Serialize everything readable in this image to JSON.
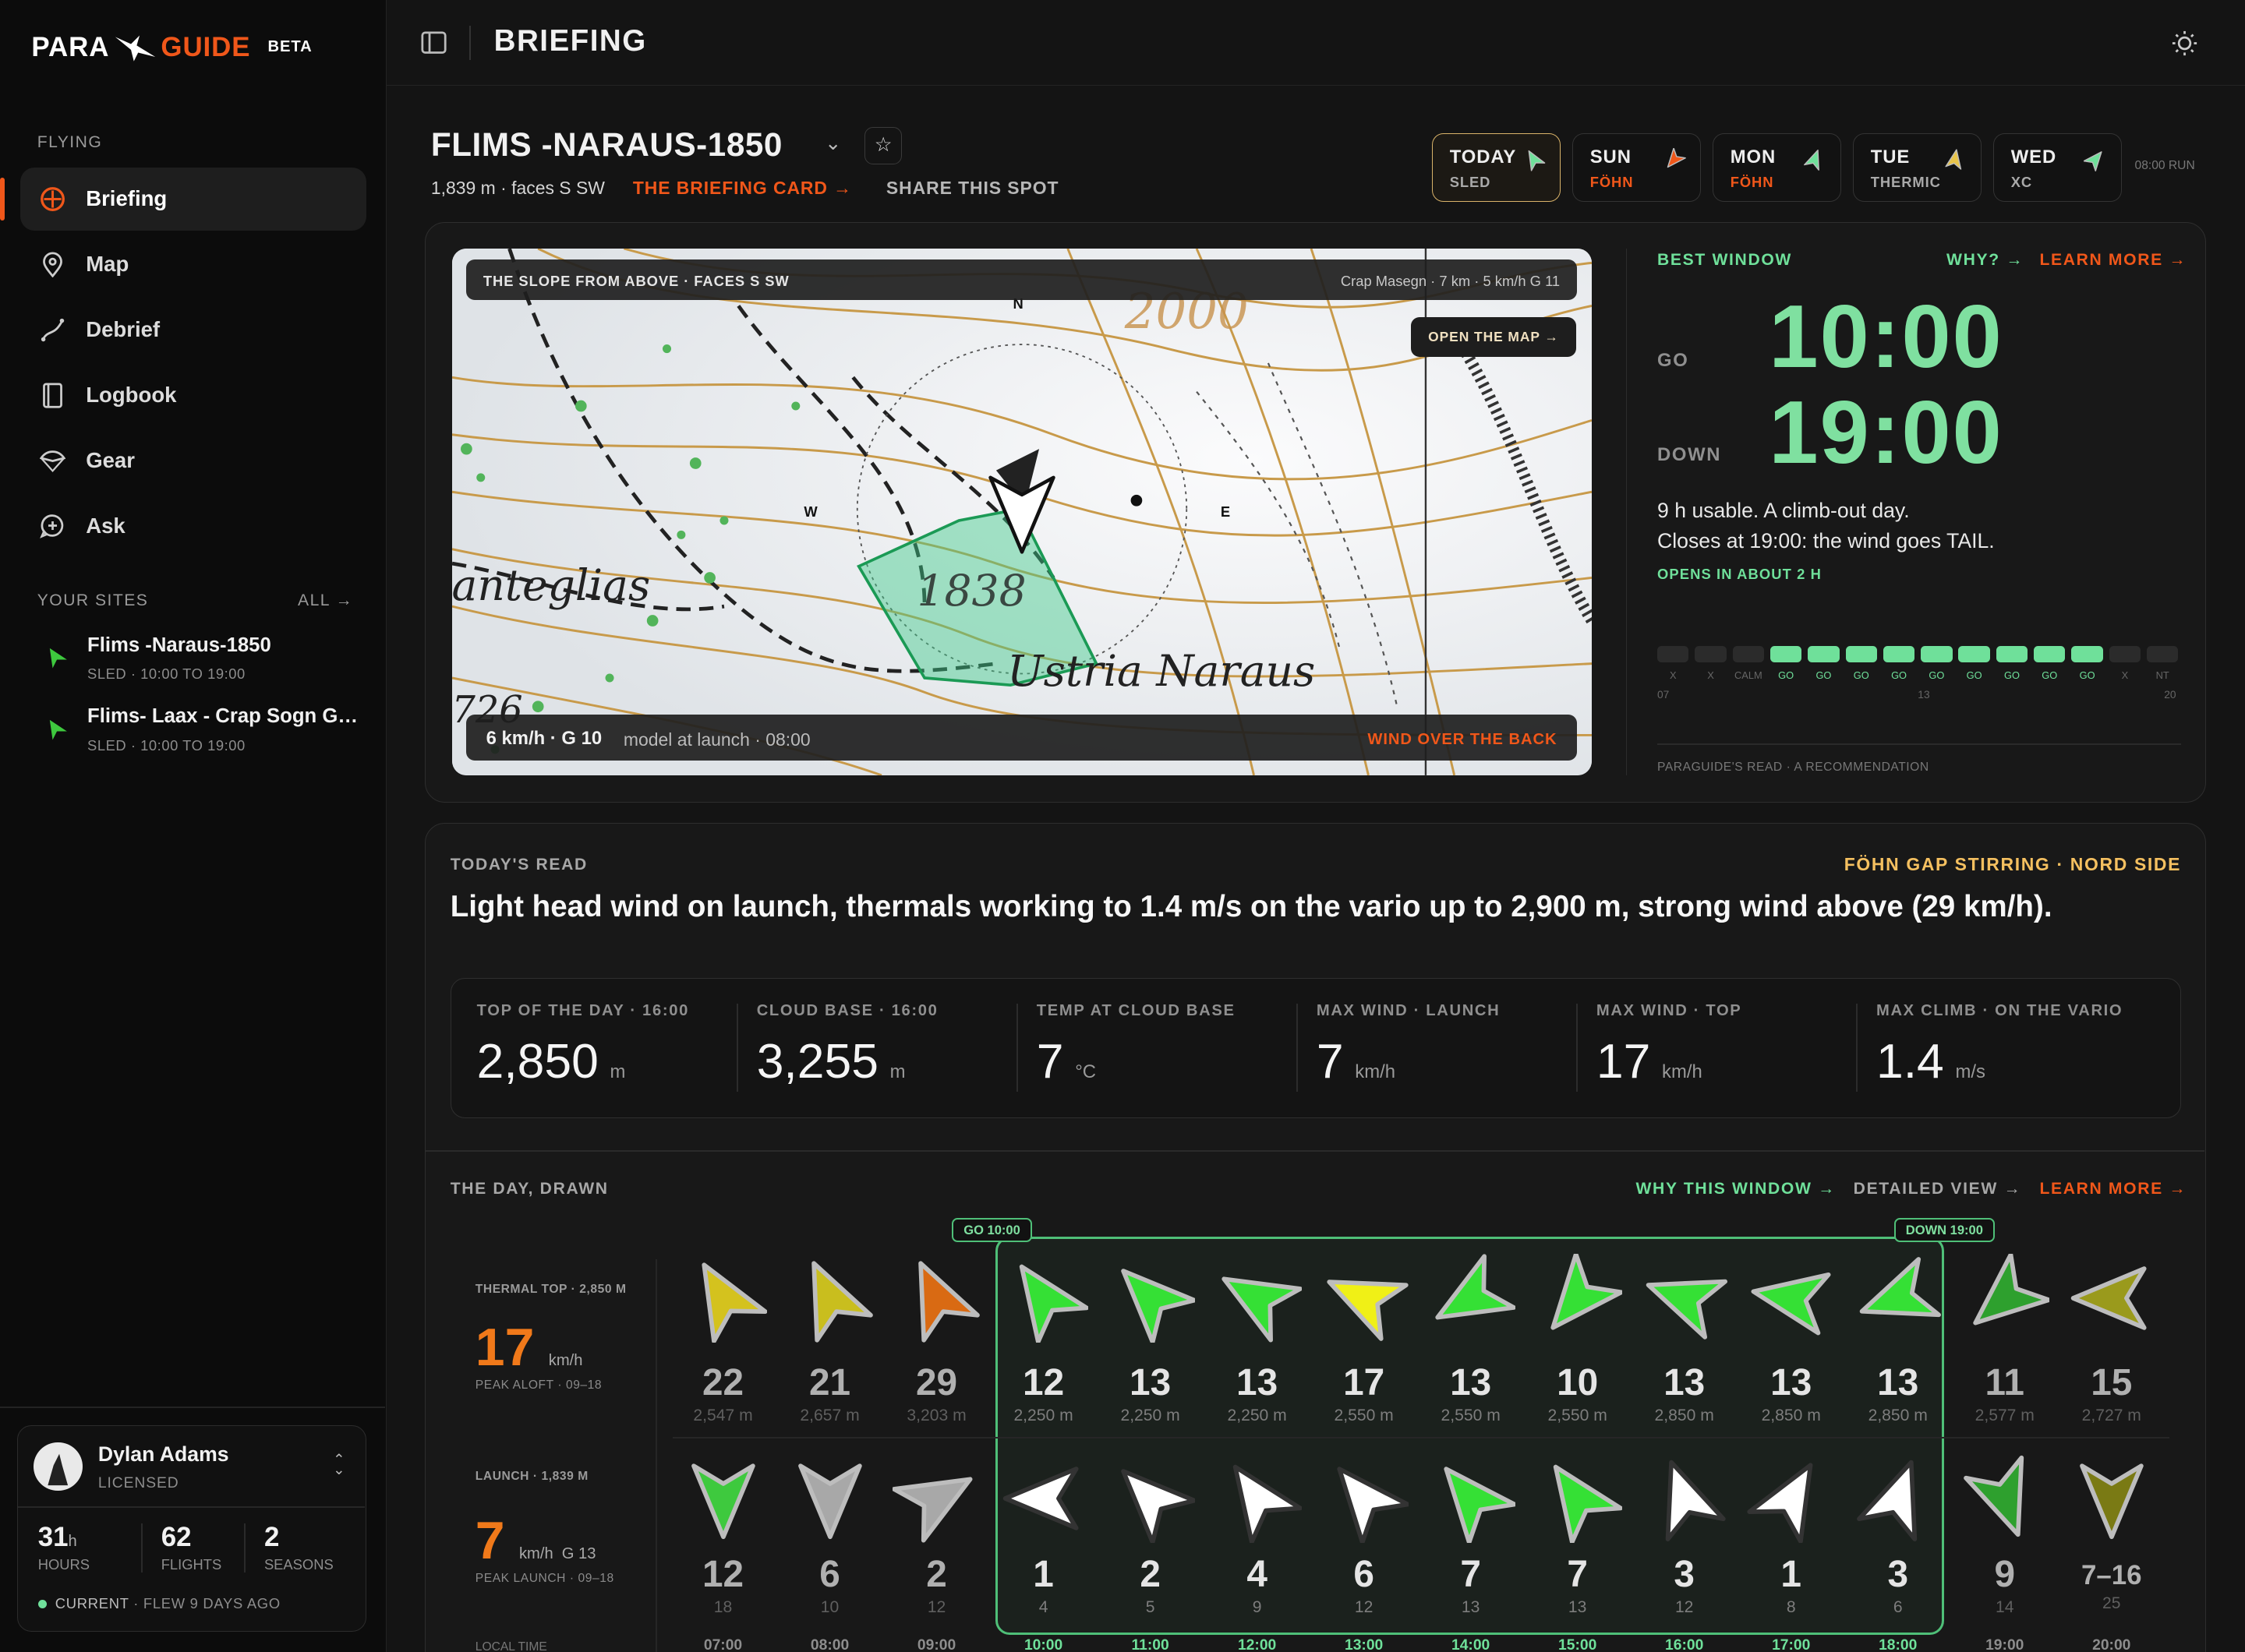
{
  "app": {
    "logo_left": "PARA",
    "logo_right": "GUIDE",
    "beta": "BETA",
    "page_title": "BRIEFING"
  },
  "sidebar": {
    "section_flying": "FLYING",
    "items": [
      {
        "label": "Briefing",
        "icon": "compass-icon"
      },
      {
        "label": "Map",
        "icon": "map-pin-icon"
      },
      {
        "label": "Debrief",
        "icon": "route-icon"
      },
      {
        "label": "Logbook",
        "icon": "book-icon"
      },
      {
        "label": "Gear",
        "icon": "paraglider-icon"
      },
      {
        "label": "Ask",
        "icon": "chat-icon"
      }
    ],
    "sites_header": "YOUR SITES",
    "sites_all": "ALL →",
    "sites": [
      {
        "name": "Flims -Naraus-1850",
        "sub": "SLED · 10:00 TO 19:00"
      },
      {
        "name": "Flims- Laax - Crap Sogn Gi...",
        "sub": "SLED · 10:00 TO 19:00"
      }
    ],
    "user": {
      "name": "Dylan Adams",
      "status": "LICENSED",
      "hours": "31",
      "hours_unit": "h",
      "hours_label": "HOURS",
      "flights": "62",
      "flights_label": "FLIGHTS",
      "seasons": "2",
      "seasons_label": "SEASONS",
      "current": "CURRENT",
      "last_flew": "· FLEW 9 DAYS AGO"
    }
  },
  "site": {
    "name": "FLIMS -NARAUS-1850",
    "meta": "1,839 m · faces S SW",
    "card_link": "THE BRIEFING CARD →",
    "share": "SHARE THIS SPOT"
  },
  "days": [
    {
      "d": "TODAY",
      "s": "SLED",
      "color": "#6fe09a",
      "rot": -30
    },
    {
      "d": "SUN",
      "s": "FÖHN",
      "color": "#f0571a",
      "rot": -140
    },
    {
      "d": "MON",
      "s": "FÖHN",
      "color": "#6fe09a",
      "rot": 20
    },
    {
      "d": "TUE",
      "s": "THERMIC",
      "color": "#e8c44a",
      "rot": 10
    },
    {
      "d": "WED",
      "s": "XC",
      "color": "#6fe09a",
      "rot": 40
    }
  ],
  "run": "08:00 RUN",
  "map": {
    "caption": "THE SLOPE FROM ABOVE · FACES S SW",
    "station": "Crap Masegn · 7 km · 5 km/h G 11",
    "open": "OPEN THE MAP →",
    "wind": "6 km/h · G 10",
    "wind_note": "model at launch · 08:00",
    "warn": "WIND OVER THE BACK",
    "n": "N",
    "w": "W",
    "e": "E",
    "label_a": "anteglias",
    "label_b": "Ustria Naraus",
    "label_c": "1838",
    "label_d": "2000",
    "label_e": "726"
  },
  "window": {
    "title": "BEST WINDOW",
    "why": "WHY? →",
    "learn": "LEARN MORE →",
    "go_label": "GO",
    "go": "10:00",
    "down_label": "DOWN",
    "down": "19:00",
    "line1": "9 h usable. A climb-out day.",
    "line2": "Closes at 19:00: the wind goes TAIL.",
    "opens": "OPENS IN ABOUT 2 H",
    "bars": [
      "X",
      "X",
      "CALM",
      "GO",
      "GO",
      "GO",
      "GO",
      "GO",
      "GO",
      "GO",
      "GO",
      "GO",
      "X",
      "NT"
    ],
    "bar_state": [
      0,
      0,
      0,
      1,
      1,
      1,
      1,
      1,
      1,
      1,
      1,
      1,
      0,
      0
    ],
    "axis_start": "07",
    "axis_mid": "13",
    "axis_end": "20",
    "footer": "PARAGUIDE'S READ · A RECOMMENDATION"
  },
  "read": {
    "title": "TODAY'S READ",
    "tag": "FÖHN GAP STIRRING · NORD SIDE",
    "headline": "Light head wind on launch, thermals working to 1.4 m/s on the vario up to 2,900 m, strong wind above (29 km/h).",
    "stats": [
      {
        "t": "TOP OF THE DAY · 16:00",
        "v": "2,850",
        "u": "m"
      },
      {
        "t": "CLOUD BASE · 16:00",
        "v": "3,255",
        "u": "m"
      },
      {
        "t": "TEMP AT CLOUD BASE",
        "v": "7",
        "u": "°C"
      },
      {
        "t": "MAX WIND · LAUNCH",
        "v": "7",
        "u": "km/h"
      },
      {
        "t": "MAX WIND · TOP",
        "v": "17",
        "u": "km/h"
      },
      {
        "t": "MAX CLIMB · ON THE VARIO",
        "v": "1.4",
        "u": "m/s"
      }
    ]
  },
  "day": {
    "title": "THE DAY, DRAWN",
    "why": "WHY THIS WINDOW →",
    "detail": "DETAILED VIEW →",
    "learn": "LEARN MORE →",
    "go_tag": "GO 10:00",
    "down_tag": "DOWN 19:00",
    "thermal_label": "THERMAL TOP · 2,850 M",
    "thermal_value": "17",
    "thermal_unit": "km/h",
    "thermal_sub": "PEAK ALOFT · 09–18",
    "launch_label": "LAUNCH · 1,839 M",
    "launch_value": "7",
    "launch_unit": "km/h",
    "launch_gust": "G 13",
    "launch_sub": "PEAK LAUNCH · 09–18",
    "local_time": "LOCAL TIME",
    "hours": [
      {
        "t": "07:00",
        "ts": "22",
        "ta": "2,547 m",
        "tc": "#d4c21e",
        "tr": -30,
        "ls": "12",
        "lg": "18",
        "lc": "#3ec93e",
        "lr": 180,
        "in": false
      },
      {
        "t": "08:00",
        "ts": "21",
        "ta": "2,657 m",
        "tc": "#c9be1e",
        "tr": -25,
        "ls": "6",
        "lg": "10",
        "lc": "#a8a8a8",
        "lr": 180,
        "in": false
      },
      {
        "t": "09:00",
        "ts": "29",
        "ta": "3,203 m",
        "tc": "#d96a13",
        "tr": -25,
        "ls": "2",
        "lg": "12",
        "lc": "#a8a8a8",
        "lr": 60,
        "in": false
      },
      {
        "t": "10:00",
        "ts": "12",
        "ta": "2,250 m",
        "tc": "#35e035",
        "tr": -35,
        "ls": "1",
        "lg": "4",
        "lc": "#ffffff",
        "lr": -90,
        "in": true
      },
      {
        "t": "11:00",
        "ts": "13",
        "ta": "2,250 m",
        "tc": "#35e035",
        "tr": -45,
        "ls": "2",
        "lg": "5",
        "lc": "#ffffff",
        "lr": -45,
        "in": true
      },
      {
        "t": "12:00",
        "ts": "13",
        "ta": "2,250 m",
        "tc": "#35e035",
        "tr": -60,
        "ls": "4",
        "lg": "9",
        "lc": "#ffffff",
        "lr": -35,
        "in": true
      },
      {
        "t": "13:00",
        "ts": "17",
        "ta": "2,550 m",
        "tc": "#f0f016",
        "tr": -65,
        "ls": "6",
        "lg": "12",
        "lc": "#ffffff",
        "lr": -40,
        "in": true
      },
      {
        "t": "14:00",
        "ts": "13",
        "ta": "2,550 m",
        "tc": "#35e035",
        "tr": -120,
        "ls": "7",
        "lg": "13",
        "lc": "#35e035",
        "lr": -40,
        "in": true
      },
      {
        "t": "15:00",
        "ts": "10",
        "ta": "2,550 m",
        "tc": "#35e035",
        "tr": -140,
        "ls": "7",
        "lg": "13",
        "lc": "#35e035",
        "lr": -35,
        "in": true
      },
      {
        "t": "16:00",
        "ts": "13",
        "ta": "2,850 m",
        "tc": "#35e035",
        "tr": -70,
        "ls": "3",
        "lg": "12",
        "lc": "#ffffff",
        "lr": -20,
        "in": true
      },
      {
        "t": "17:00",
        "ts": "13",
        "ta": "2,850 m",
        "tc": "#35e035",
        "tr": -80,
        "ls": "1",
        "lg": "8",
        "lc": "#ffffff",
        "lr": 30,
        "in": true
      },
      {
        "t": "18:00",
        "ts": "13",
        "ta": "2,850 m",
        "tc": "#35e035",
        "tr": -110,
        "ls": "3",
        "lg": "6",
        "lc": "#ffffff",
        "lr": 20,
        "in": true
      },
      {
        "t": "19:00",
        "ts": "11",
        "ta": "2,577 m",
        "tc": "#2ea02e",
        "tr": -130,
        "ls": "9",
        "lg": "14",
        "lc": "#2ea02e",
        "lr": 160,
        "in": false
      },
      {
        "t": "20:00",
        "ts": "15",
        "ta": "2,727 m",
        "tc": "#9a9a1c",
        "tr": -90,
        "ls": "7–16",
        "lg": "25",
        "lc": "#7a7a14",
        "lr": 180,
        "in": false
      }
    ]
  },
  "colors": {
    "accent": "#f0571a",
    "go": "#6fe09a",
    "window_border": "#4fbf78"
  }
}
